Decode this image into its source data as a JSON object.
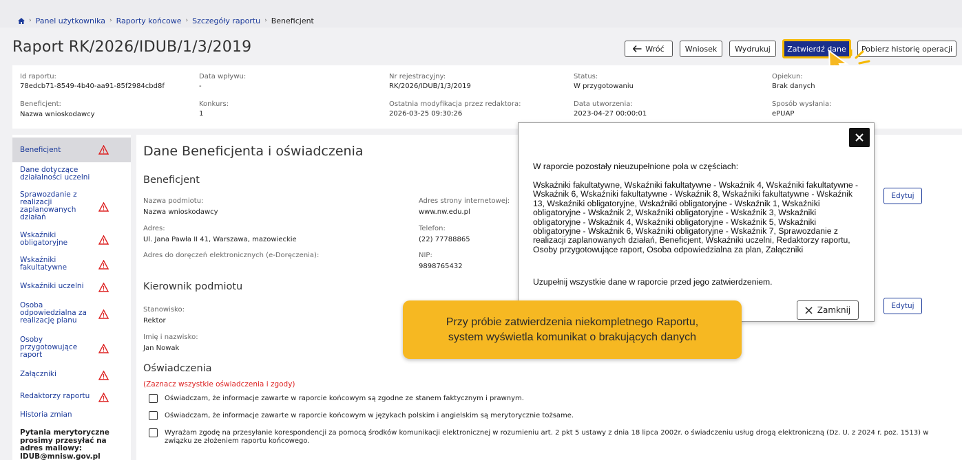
{
  "breadcrumb": {
    "items": [
      "Panel użytkownika",
      "Raporty końcowe",
      "Szczegóły raportu"
    ],
    "current": "Beneficjent"
  },
  "page_title": "Raport RK/2026/IDUB/1/3/2019",
  "toolbar": {
    "back_label": "Wróć",
    "wniosek_label": "Wniosek",
    "print_label": "Wydrukuj",
    "confirm_label": "Zatwierdź dane",
    "history_label": "Pobierz historię operacji"
  },
  "meta": {
    "id_label": "Id raportu:",
    "id_value": "78edcb71-8549-4b40-aa91-85f2984cbd8f",
    "date_label": "Data wpływu:",
    "date_value": "-",
    "reg_label": "Nr rejestracyjny:",
    "reg_value": "RK/2026/IDUB/1/3/2019",
    "status_label": "Status:",
    "status_value": "W przygotowaniu",
    "guardian_label": "Opiekun:",
    "guardian_value": "Brak danych",
    "beneficiary_label": "Beneficjent:",
    "beneficiary_value": "Nazwa wnioskodawcy",
    "contest_label": "Konkurs:",
    "contest_value": "1",
    "lastmod_label": "Ostatnia modyfikacja przez redaktora:",
    "lastmod_value": "2026-03-25 09:30:26",
    "created_label": "Data utworzenia:",
    "created_value": "2023-04-27 00:00:01",
    "send_label": "Sposób wysłania:",
    "send_value": "ePUAP"
  },
  "sidebar": {
    "items": [
      {
        "label": "Beneficjent",
        "warn": true
      },
      {
        "label": "Dane dotyczące działalności uczelni",
        "warn": false
      },
      {
        "label": "Sprawozdanie z realizacji zaplanowanych działań",
        "warn": true
      },
      {
        "label": "Wskaźniki obligatoryjne",
        "warn": true
      },
      {
        "label": "Wskaźniki fakultatywne",
        "warn": true
      },
      {
        "label": "Wskaźniki uczelni",
        "warn": true
      },
      {
        "label": "Osoba odpowiedzialna za realizację planu",
        "warn": true
      },
      {
        "label": "Osoby przygotowujące raport",
        "warn": true
      },
      {
        "label": "Załączniki",
        "warn": true
      },
      {
        "label": "Redaktorzy raportu",
        "warn": true
      },
      {
        "label": "Historia zmian",
        "warn": false
      }
    ],
    "info": "Pytania merytoryczne prosimy przesyłać na adres mailowy: IDUB@mnisw.gov.pl"
  },
  "main": {
    "title": "Dane Beneficjenta i oświadczenia",
    "beneficiary_heading": "Beneficjent",
    "name_label": "Nazwa podmiotu:",
    "name_value": "Nazwa wnioskodawcy",
    "www_label": "Adres strony internetowej:",
    "www_value": "www.nw.edu.pl",
    "address_label": "Adres:",
    "address_value": "Ul. Jana Pawła II 41, Warszawa, mazowieckie",
    "phone_label": "Telefon:",
    "phone_value": "(22) 77788865",
    "edelivery_label": "Adres do doręczeń elektronicznych (e-Doręczenia):",
    "nip_label": "NIP:",
    "nip_value": "9898765432",
    "edit_label": "Edytuj",
    "head_heading": "Kierownik podmiotu",
    "position_label": "Stanowisko:",
    "position_value": "Rektor",
    "fullname_label": "Imię i nazwisko:",
    "fullname_value": "Jan Nowak",
    "decl_heading": "Oświadczenia",
    "decl_note": "(Zaznacz wszystkie oświadczenia i zgody)",
    "declarations": [
      "Oświadczam, że informacje zawarte w raporcie końcowym są zgodne ze stanem faktycznym i prawnym.",
      "Oświadczam, że informacje zawarte w raporcie końcowym w językach polskim i angielskim są merytorycznie tożsame.",
      "Wyrażam zgodę na przesyłanie korespondencji za pomocą środków komunikacji elektronicznej w rozumieniu art. 2 pkt 5 ustawy z dnia 18 lipca 2002r. o świadczeniu usług drogą elektroniczną (Dz. U. z 2024 r. poz. 1513) w związku ze złożeniem raportu końcowego."
    ]
  },
  "modal": {
    "intro": "W raporcie pozostały nieuzupełnione pola w częściach:",
    "list": "Wskaźniki fakultatywne, Wskaźniki fakultatywne - Wskaźnik 4, Wskaźniki fakultatywne - Wskaźnik 6, Wskaźniki fakultatywne - Wskaźnik 8, Wskaźniki fakultatywne - Wskaźnik 13, Wskaźniki obligatoryjne, Wskaźniki obligatoryjne - Wskaźnik 1, Wskaźniki obligatoryjne - Wskaźnik 2, Wskaźniki obligatoryjne - Wskaźnik 3, Wskaźniki obligatoryjne - Wskaźnik 4, Wskaźniki obligatoryjne - Wskaźnik 5, Wskaźniki obligatoryjne - Wskaźnik 6, Wskaźniki obligatoryjne - Wskaźnik 7, Sprawozdanie z realizacji zaplanowanych działań, Beneficjent, Wskaźniki uczelni, Redaktorzy raportu, Osoby przygotowujące raport, Osoba odpowiedzialna za plan, Załączniki",
    "outro": "Uzupełnij wszystkie dane w raporcie przed jego zatwierdzeniem.",
    "close_label": "Zamknij"
  },
  "tooltip": {
    "line1": "Przy próbie zatwierdzenia niekompletnego Raportu,",
    "line2": "system wyświetla komunikat o brakujących danych"
  },
  "colors": {
    "accent": "#1a2f8c",
    "highlight": "#f5b800",
    "warning": "#d22222",
    "tooltip": "#f6b822"
  }
}
